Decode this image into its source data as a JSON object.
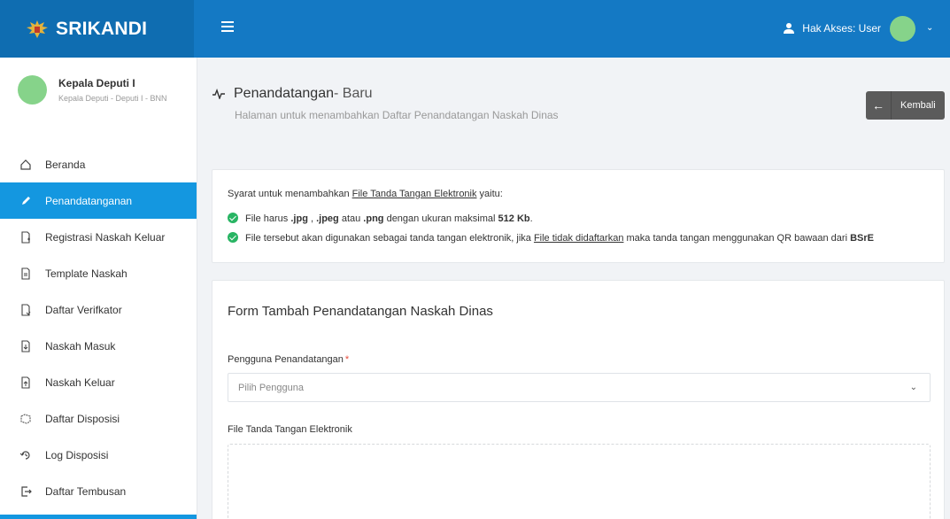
{
  "app": {
    "name": "SRIKANDI"
  },
  "header": {
    "access_label": "Hak Akses: User"
  },
  "profile": {
    "name": "Kepala Deputi I",
    "role": "Kepala Deputi - Deputi I - BNN"
  },
  "sidebar": {
    "items": [
      {
        "label": "Beranda",
        "icon": "home-icon"
      },
      {
        "label": "Penandatanganan",
        "icon": "pen-icon",
        "active": true
      },
      {
        "label": "Registrasi Naskah Keluar",
        "icon": "file-plus-icon"
      },
      {
        "label": "Template Naskah",
        "icon": "file-text-icon"
      },
      {
        "label": "Daftar Verifkator",
        "icon": "file-check-icon"
      },
      {
        "label": "Naskah Masuk",
        "icon": "file-in-icon"
      },
      {
        "label": "Naskah Keluar",
        "icon": "file-out-icon"
      },
      {
        "label": "Daftar Disposisi",
        "icon": "share-icon"
      },
      {
        "label": "Log Disposisi",
        "icon": "history-icon"
      },
      {
        "label": "Daftar Tembusan",
        "icon": "export-icon"
      }
    ]
  },
  "page": {
    "title_main": "Penandatangan",
    "title_suffix": " - Baru",
    "subtitle": "Halaman untuk menambahkan Daftar Penandatangan Naskah Dinas",
    "back_label": "Kembali"
  },
  "info": {
    "intro_prefix": "Syarat untuk menambahkan ",
    "intro_link": "File Tanda Tangan Elektronik",
    "intro_suffix": " yaitu:",
    "rule1_a": "File harus ",
    "rule1_b": ".jpg",
    "rule1_c": " , ",
    "rule1_d": ".jpeg",
    "rule1_e": " atau ",
    "rule1_f": ".png",
    "rule1_g": " dengan ukuran maksimal ",
    "rule1_h": "512 Kb",
    "rule1_i": ".",
    "rule2_a": "File tersebut akan digunakan sebagai tanda tangan elektronik, jika ",
    "rule2_link": "File tidak didaftarkan",
    "rule2_b": " maka tanda tangan menggunakan QR bawaan dari ",
    "rule2_c": "BSrE"
  },
  "form": {
    "title": "Form Tambah Penandatangan Naskah Dinas",
    "user_label": "Pengguna Penandatangan",
    "required_mark": "*",
    "user_placeholder": "Pilih Pengguna",
    "file_label": "File Tanda Tangan Elektronik"
  },
  "colors": {
    "topbar": "#1479c4",
    "active": "#1497e0",
    "success": "#28b463"
  }
}
